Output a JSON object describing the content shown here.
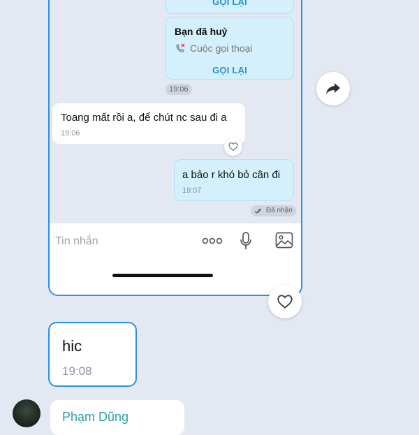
{
  "quoted_screenshot": {
    "call_card_1": {
      "callback_label": "GỌI LẠI"
    },
    "call_card_2": {
      "title": "Bạn đã huỷ",
      "subtitle": "Cuộc gọi thoại",
      "callback_label": "GỌI LẠI"
    },
    "time_pill": "19:06",
    "incoming_message": {
      "text": "Toang mất rồi a, để chút nc sau đi a",
      "time": "19:06"
    },
    "outgoing_message": {
      "text": "a bảo r khó bỏ cân đi",
      "time": "19:07"
    },
    "status": "Đã nhận",
    "input": {
      "placeholder": "Tin nhắn"
    }
  },
  "hic_message": {
    "text": "hic",
    "time": "19:08"
  },
  "next_sender": {
    "name": "Phạm Dũng"
  },
  "icons": {
    "share": "share-arrow-icon",
    "like": "heart-icon",
    "more": "more-dots-icon",
    "mic": "microphone-icon",
    "gallery": "image-icon"
  },
  "colors": {
    "background": "#e3e8f2",
    "outgoing_bubble": "#d3f0fc",
    "accent": "#2b8fe6",
    "callback_text": "#2b8fc9"
  }
}
